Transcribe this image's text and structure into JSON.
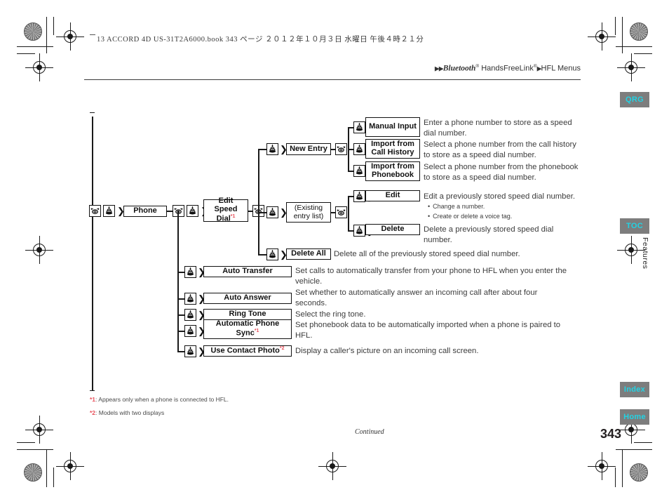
{
  "print_header": "13 ACCORD 4D US-31T2A6000.book   343 ページ   ２０１２年１０月３日   水曜日   午後４時２１分",
  "breadcrumb": {
    "arrow_double": "▶▶",
    "arrow_single": "▶",
    "brand": "Bluetooth",
    "brand_reg": "®",
    "product": "HandsFreeLink",
    "product_reg": "®",
    "section": "HFL Menus"
  },
  "side_tabs": [
    {
      "label": "QRG"
    },
    {
      "label": "TOC"
    },
    {
      "label": "Index"
    },
    {
      "label": "Home"
    }
  ],
  "vertical_tab_label": "Features",
  "page_number": "343",
  "continued_label": "Continued",
  "icons": {
    "rotate": "rotary-knob-rotate-icon",
    "press": "rotary-knob-press-icon",
    "arrow": "〉"
  },
  "diagram": {
    "root_box": {
      "label": "Phone"
    },
    "level2": [
      {
        "label": "Edit Speed Dial",
        "footnote": "*1"
      },
      {
        "label": "Auto Transfer",
        "footnote": ""
      },
      {
        "label": "Auto Answer",
        "footnote": ""
      },
      {
        "label": "Ring Tone",
        "footnote": ""
      },
      {
        "label": "Automatic Phone Sync",
        "footnote": "*1"
      },
      {
        "label": "Use Contact Photo",
        "footnote": "*2"
      }
    ],
    "level3": [
      {
        "label": "New Entry"
      },
      {
        "label": "(Existing entry list)"
      },
      {
        "label": "Delete All"
      }
    ],
    "new_entry_children": [
      {
        "label": "Manual Input"
      },
      {
        "label": "Import from Call History"
      },
      {
        "label": "Import from Phonebook"
      }
    ],
    "existing_entry_children": [
      {
        "label": "Edit"
      },
      {
        "label": "Delete"
      }
    ],
    "descriptions": {
      "manual_input": "Enter a phone number to store as a speed dial number.",
      "import_call_history": "Select a phone number from the call history to store as a speed dial number.",
      "import_phonebook": "Select a phone number from the phonebook to store as a speed dial number.",
      "edit": "Edit a previously stored speed dial number.",
      "edit_bullets": [
        "Change a number.",
        "Create or delete a voice tag."
      ],
      "delete": "Delete a previously stored speed dial number.",
      "delete_all": "Delete all of the previously stored speed dial number.",
      "auto_transfer": "Set calls to automatically transfer from your phone to HFL when you enter the vehicle.",
      "auto_answer": "Set whether to automatically answer an incoming call after about four seconds.",
      "ring_tone": "Select the ring tone.",
      "automatic_phone_sync": "Set phonebook data to be automatically imported when a phone is paired to HFL.",
      "use_contact_photo": "Display a caller's picture on an incoming call screen."
    }
  },
  "footnotes": [
    {
      "marker": "*1",
      "text": ": Appears only when a phone is connected to HFL."
    },
    {
      "marker": "*2",
      "text": ": Models with two displays"
    }
  ],
  "colors": {
    "tab_bg": "#7d7d7d",
    "tab_text": "#22d3e4",
    "footnote_marker": "#e8505b",
    "body_text": "#3c3c3c",
    "box_border": "#111111"
  }
}
